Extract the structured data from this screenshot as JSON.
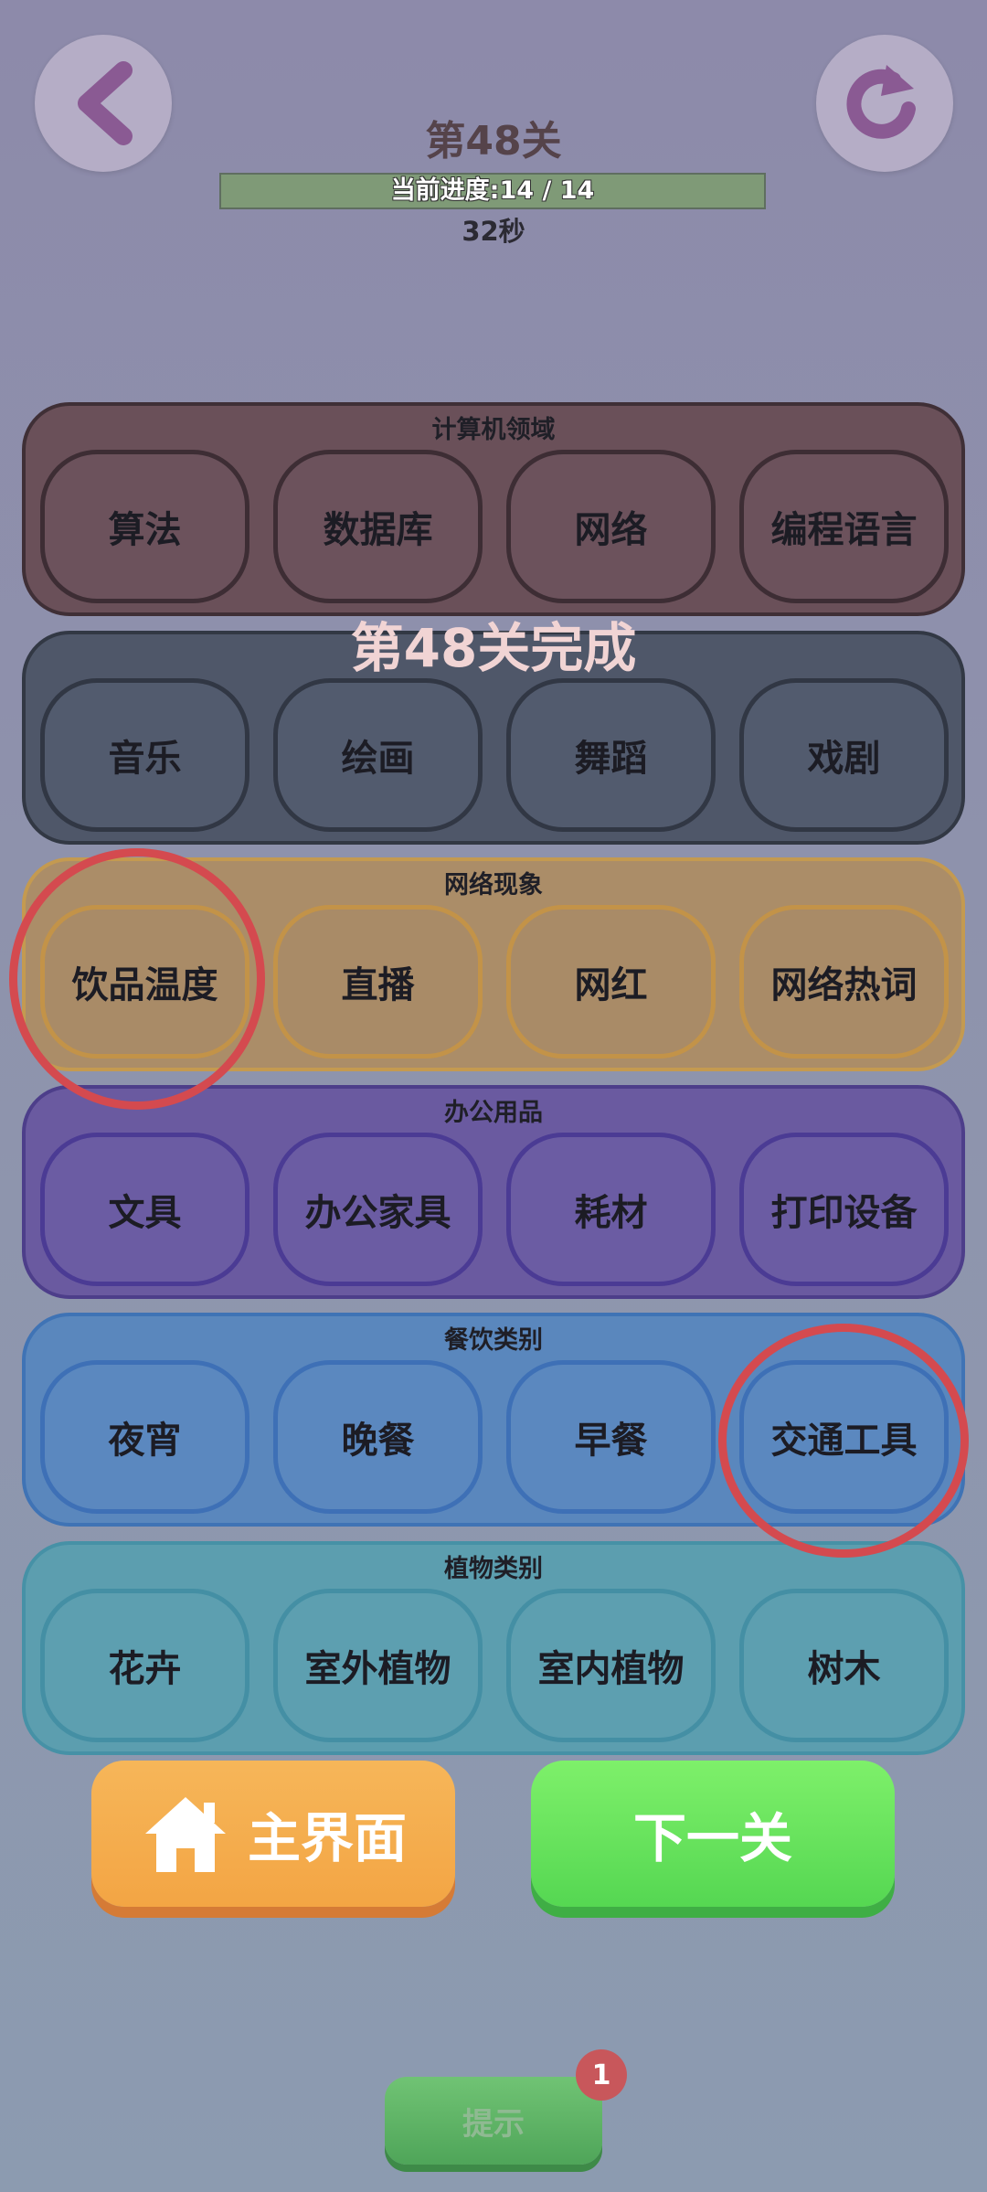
{
  "header": {
    "level_title": "第48关",
    "progress_text": "当前进度:14 / 14",
    "progress_fraction": 1.0,
    "timer": "32秒",
    "back_icon": "chevron-left-icon",
    "refresh_icon": "refresh-icon"
  },
  "overlay": {
    "complete_text": "第48关完成"
  },
  "categories": [
    {
      "title": "计算机领域",
      "items": [
        "算法",
        "数据库",
        "网络",
        "编程语言"
      ]
    },
    {
      "title": "",
      "items": [
        "音乐",
        "绘画",
        "舞蹈",
        "戏剧"
      ]
    },
    {
      "title": "网络现象",
      "items": [
        "饮品温度",
        "直播",
        "网红",
        "网络热词"
      ]
    },
    {
      "title": "办公用品",
      "items": [
        "文具",
        "办公家具",
        "耗材",
        "打印设备"
      ]
    },
    {
      "title": "餐饮类别",
      "items": [
        "夜宵",
        "晚餐",
        "早餐",
        "交通工具"
      ]
    },
    {
      "title": "植物类别",
      "items": [
        "花卉",
        "室外植物",
        "室内植物",
        "树木"
      ]
    }
  ],
  "buttons": {
    "home_label": "主界面",
    "home_icon": "home-icon",
    "next_label": "下一关",
    "hint_label": "提示",
    "hint_badge": "1"
  },
  "colors": {
    "highlight_ring": "#d44a4f",
    "home_button": "#f4aa4a",
    "next_button": "#62e25a",
    "hint_button": "#5fb266"
  }
}
